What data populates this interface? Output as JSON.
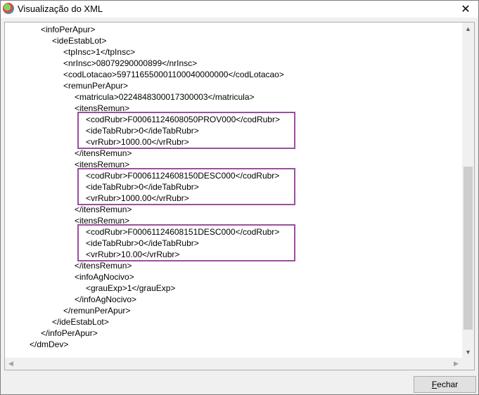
{
  "window": {
    "title": "Visualização do XML",
    "close_glyph": "✕"
  },
  "xml_lines": [
    {
      "indent": 0,
      "text": "<infoPerApur>"
    },
    {
      "indent": 1,
      "text": "<ideEstabLot>"
    },
    {
      "indent": 2,
      "text": "<tpInsc>1</tpInsc>"
    },
    {
      "indent": 2,
      "text": "<nrInsc>08079290000899</nrInsc>"
    },
    {
      "indent": 2,
      "text": "<codLotacao>597116550001100040000000</codLotacao>"
    },
    {
      "indent": 2,
      "text": "<remunPerApur>"
    },
    {
      "indent": 3,
      "text": "<matricula>0224848300017300003</matricula>"
    },
    {
      "indent": 3,
      "text": "<itensRemun>"
    },
    {
      "indent": 4,
      "text": "<codRubr>F00061124608050PROV000</codRubr>"
    },
    {
      "indent": 4,
      "text": "<ideTabRubr>0</ideTabRubr>"
    },
    {
      "indent": 4,
      "text": "<vrRubr>1000.00</vrRubr>"
    },
    {
      "indent": 3,
      "text": "</itensRemun>"
    },
    {
      "indent": 3,
      "text": "<itensRemun>"
    },
    {
      "indent": 4,
      "text": "<codRubr>F00061124608150DESC000</codRubr>"
    },
    {
      "indent": 4,
      "text": "<ideTabRubr>0</ideTabRubr>"
    },
    {
      "indent": 4,
      "text": "<vrRubr>1000.00</vrRubr>"
    },
    {
      "indent": 3,
      "text": "</itensRemun>"
    },
    {
      "indent": 3,
      "text": "<itensRemun>"
    },
    {
      "indent": 4,
      "text": "<codRubr>F00061124608151DESC000</codRubr>"
    },
    {
      "indent": 4,
      "text": "<ideTabRubr>0</ideTabRubr>"
    },
    {
      "indent": 4,
      "text": "<vrRubr>10.00</vrRubr>"
    },
    {
      "indent": 3,
      "text": "</itensRemun>"
    },
    {
      "indent": 3,
      "text": "<infoAgNocivo>"
    },
    {
      "indent": 4,
      "text": "<grauExp>1</grauExp>"
    },
    {
      "indent": 3,
      "text": "</infoAgNocivo>"
    },
    {
      "indent": 2,
      "text": "</remunPerApur>"
    },
    {
      "indent": 1,
      "text": "</ideEstabLot>"
    },
    {
      "indent": 0,
      "text": "</infoPerApur>"
    },
    {
      "indent": -1,
      "text": "</dmDev>"
    }
  ],
  "highlight_groups": [
    {
      "start": 8,
      "end": 10
    },
    {
      "start": 13,
      "end": 15
    },
    {
      "start": 18,
      "end": 20
    }
  ],
  "highlight_color": "#9b4fa0",
  "buttons": {
    "close_label_accel": "F",
    "close_label_rest": "echar"
  }
}
